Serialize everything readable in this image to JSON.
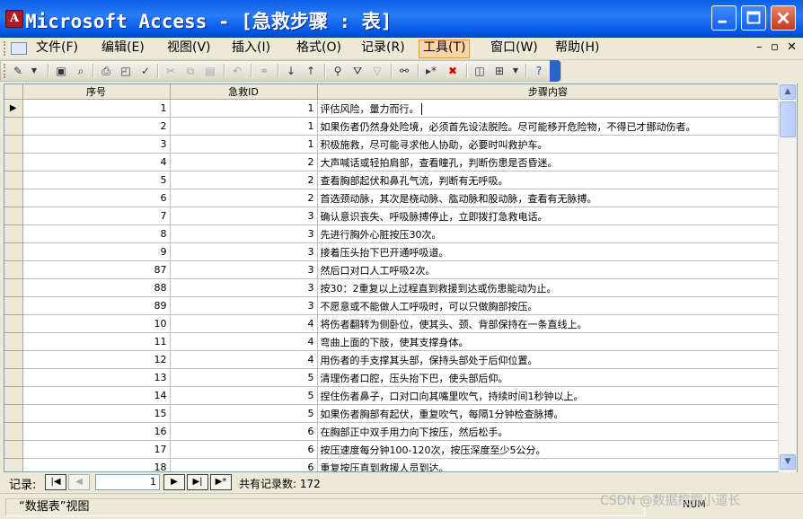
{
  "window": {
    "title": "Microsoft Access - [急救步骤 : 表]"
  },
  "menubar": {
    "items": [
      {
        "label": "文件(F)"
      },
      {
        "label": "编辑(E)"
      },
      {
        "label": "视图(V)"
      },
      {
        "label": "插入(I)"
      },
      {
        "label": "格式(O)"
      },
      {
        "label": "记录(R)"
      },
      {
        "label": "工具(T)",
        "active": true
      },
      {
        "label": "窗口(W)"
      },
      {
        "label": "帮助(H)"
      }
    ]
  },
  "table": {
    "columns": [
      "序号",
      "急救ID",
      "步骤内容"
    ],
    "rows": [
      {
        "seq": "1",
        "id": "1",
        "step": "评估风险，量力而行。",
        "current": true
      },
      {
        "seq": "2",
        "id": "1",
        "step": "如果伤者仍然身处险境，必须首先设法脱险。尽可能移开危险物，不得已才挪动伤者。"
      },
      {
        "seq": "3",
        "id": "1",
        "step": "积极施救，尽可能寻求他人协助，必要时叫救护车。"
      },
      {
        "seq": "4",
        "id": "2",
        "step": "大声喊话或轻拍肩部，查看瞳孔，判断伤患是否昏迷。"
      },
      {
        "seq": "5",
        "id": "2",
        "step": "查看胸部起伏和鼻孔气流，判断有无呼吸。"
      },
      {
        "seq": "6",
        "id": "2",
        "step": "首选颈动脉，其次是桡动脉、肱动脉和股动脉，查看有无脉搏。"
      },
      {
        "seq": "7",
        "id": "3",
        "step": "确认意识丧失、呼吸脉搏停止，立即拨打急救电话。"
      },
      {
        "seq": "8",
        "id": "3",
        "step": "先进行胸外心脏按压30次。"
      },
      {
        "seq": "9",
        "id": "3",
        "step": "接着压头抬下巴开通呼吸道。"
      },
      {
        "seq": "87",
        "id": "3",
        "step": "然后口对口人工呼吸2次。"
      },
      {
        "seq": "88",
        "id": "3",
        "step": "按30：2重复以上过程直到救援到达或伤患能动为止。"
      },
      {
        "seq": "89",
        "id": "3",
        "step": "不愿意或不能做人工呼吸时，可以只做胸部按压。"
      },
      {
        "seq": "10",
        "id": "4",
        "step": "将伤者翻转为侧卧位，使其头、颈、背部保持在一条直线上。"
      },
      {
        "seq": "11",
        "id": "4",
        "step": "弯曲上面的下肢，使其支撑身体。"
      },
      {
        "seq": "12",
        "id": "4",
        "step": "用伤者的手支撑其头部，保持头部处于后仰位置。"
      },
      {
        "seq": "13",
        "id": "5",
        "step": "清理伤者口腔，压头抬下巴，使头部后仰。"
      },
      {
        "seq": "14",
        "id": "5",
        "step": "捏住伤者鼻子，口对口向其嘴里吹气，持续时间1秒钟以上。"
      },
      {
        "seq": "15",
        "id": "5",
        "step": "如果伤者胸部有起伏，重复吹气，每隔1分钟检查脉搏。"
      },
      {
        "seq": "16",
        "id": "6",
        "step": "在胸部正中双手用力向下按压，然后松手。"
      },
      {
        "seq": "17",
        "id": "6",
        "step": "按压速度每分钟100-120次，按压深度至少5公分。"
      },
      {
        "seq": "18",
        "id": "6",
        "step": "重复按压直到救援人员到达。"
      }
    ]
  },
  "navigator": {
    "label": "记录:",
    "current_record": "1",
    "total_label": "共有记录数: 172"
  },
  "statusbar": {
    "text": "“数据表”视图",
    "num": "NUM"
  },
  "watermark": "CSDN @数据挖掘小道长",
  "colors": {
    "titlebar": "#0a5fe8",
    "menu_active": "#fcd5a0",
    "chrome": "#ece9d8"
  }
}
